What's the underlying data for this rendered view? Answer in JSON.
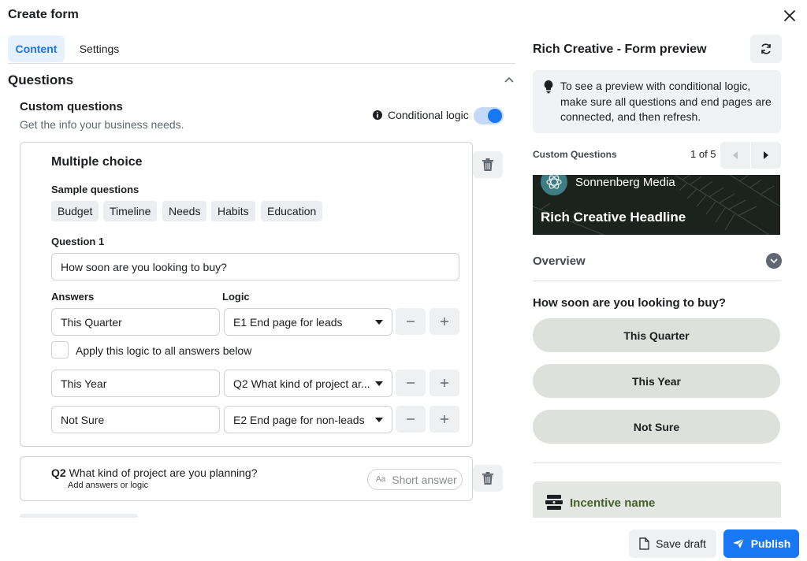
{
  "dialog": {
    "title": "Create form"
  },
  "tabs": [
    {
      "label": "Content"
    },
    {
      "label": "Settings"
    }
  ],
  "questions_section": {
    "title": "Questions",
    "custom": {
      "title": "Custom questions",
      "subtitle": "Get the info your business needs.",
      "conditional_logic_label": "Conditional logic"
    },
    "card": {
      "type_label": "Multiple choice",
      "sample_label": "Sample questions",
      "samples": [
        "Budget",
        "Timeline",
        "Needs",
        "Habits",
        "Education"
      ],
      "question_label": "Question 1",
      "question_value": "How soon are you looking to buy?",
      "answers_label": "Answers",
      "logic_label": "Logic",
      "rows": [
        {
          "answer": "This Quarter",
          "logic": "E1 End page for leads"
        },
        {
          "answer": "This Year",
          "logic": "Q2 What kind of project ar..."
        },
        {
          "answer": "Not Sure",
          "logic": "E2 End page for non-leads"
        }
      ],
      "apply_all_label": "Apply this logic to all answers below"
    },
    "q2": {
      "prefix": "Q2",
      "title": "What kind of project are you planning?",
      "sub": "Add answers or logic",
      "badge_icon_text": "Aa",
      "badge": "Short answer"
    }
  },
  "preview": {
    "title": "Rich Creative - Form preview",
    "info": "To see a preview with conditional logic, make sure all questions and end pages are connected, and then refresh.",
    "section_label": "Custom Questions",
    "pager": "1 of 5",
    "brand": "Sonnenberg Media",
    "headline": "Rich Creative Headline",
    "overview": "Overview",
    "question": "How soon are you looking to buy?",
    "options": [
      "This Quarter",
      "This Year",
      "Not Sure"
    ],
    "incentive": "Incentive name"
  },
  "footer": {
    "save_draft": "Save draft",
    "publish": "Publish"
  },
  "colors": {
    "accent": "#1877f2",
    "incentive_green": "#44612a",
    "pill": "#dde0db"
  }
}
